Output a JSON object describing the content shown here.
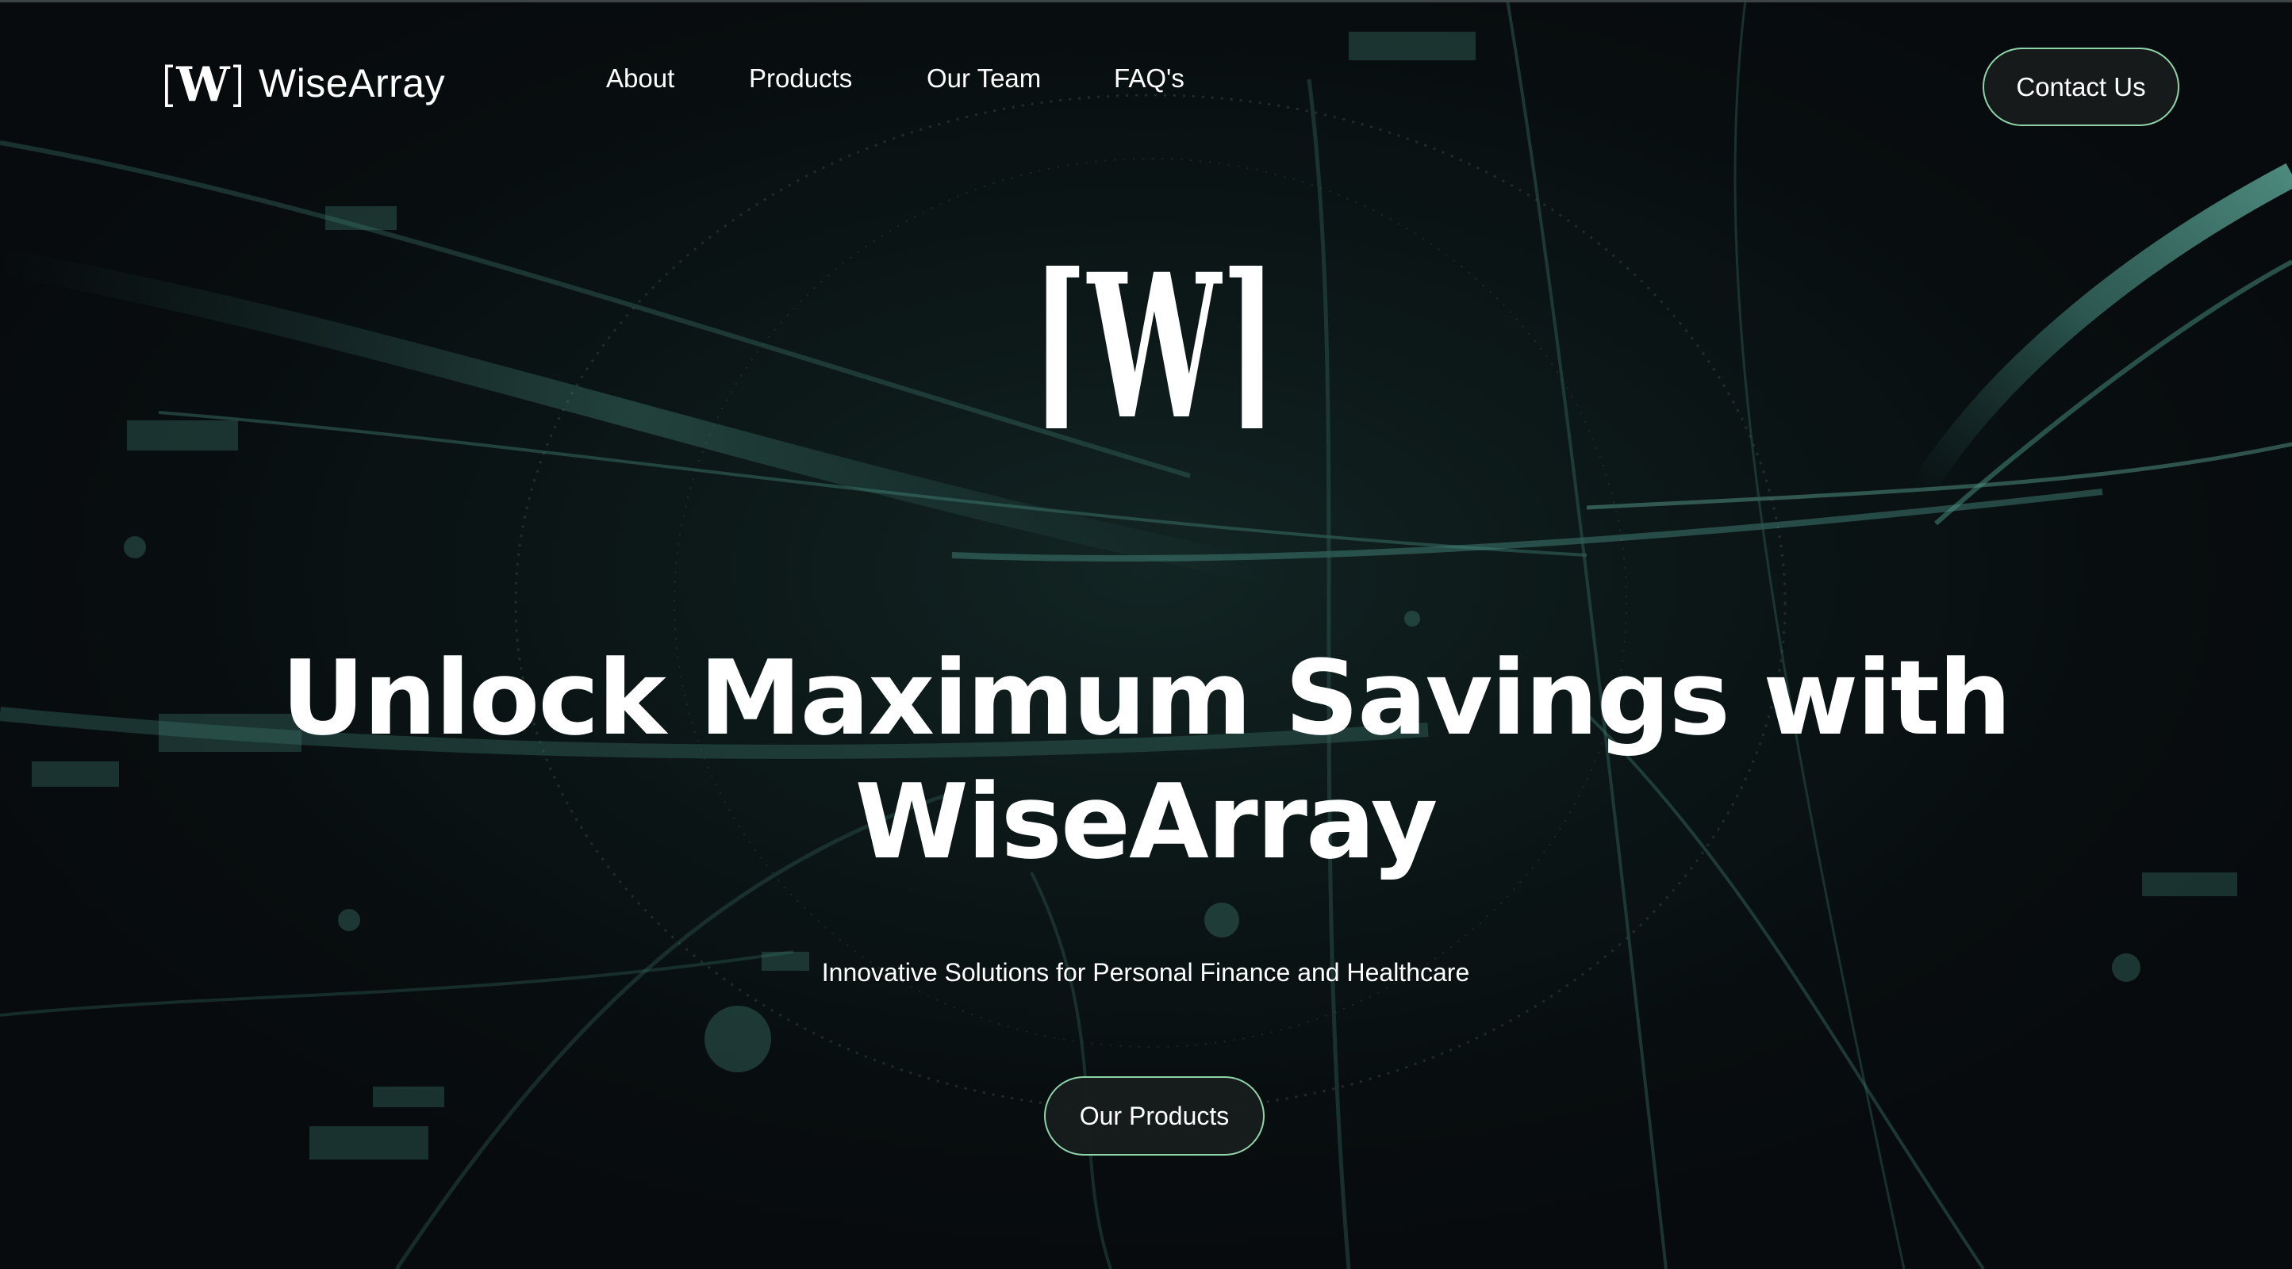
{
  "brand": {
    "logo_text": "[W]",
    "name": "WiseArray"
  },
  "nav": {
    "links": [
      "About",
      "Products",
      "Our Team",
      "FAQ's"
    ],
    "contact_label": "Contact Us"
  },
  "hero": {
    "logo_text": "[W]",
    "title_line1": "Unlock Maximum Savings with",
    "title_line2": "WiseArray",
    "subtitle": "Innovative Solutions for Personal Finance and Healthcare",
    "cta_label": "Our Products"
  },
  "colors": {
    "background": "#0a0f10",
    "accent_green": "#8fd4a8",
    "streak_teal": "#3e7a70",
    "button_fill": "#181c1c",
    "text": "#ffffff"
  }
}
